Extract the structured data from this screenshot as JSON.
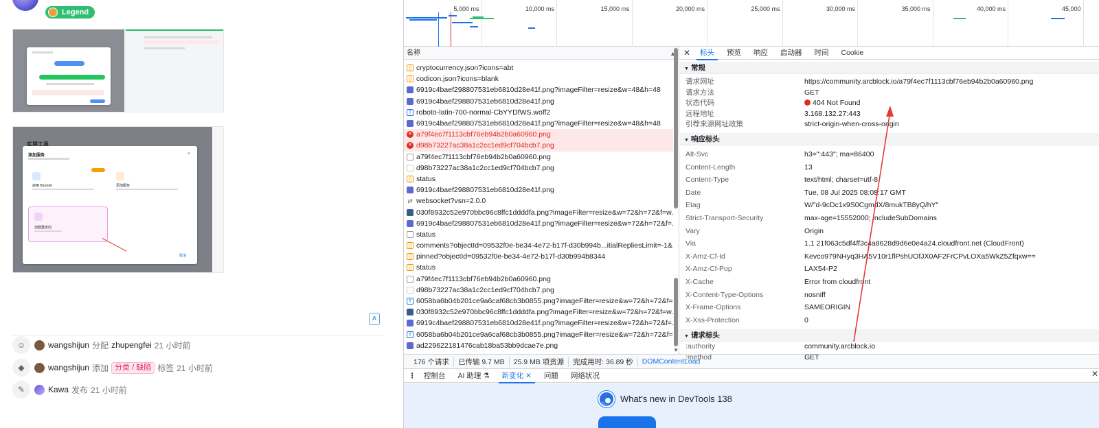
{
  "left": {
    "badge": "Legend",
    "activity": [
      {
        "icon": "person-icon",
        "user": "wangshijun",
        "action": "分配",
        "target": "zhupengfei",
        "time": "21 小时前"
      },
      {
        "icon": "tag-icon",
        "user": "wangshijun",
        "action": "添加",
        "tag": "分类 / 缺陷",
        "suffix": "标签",
        "time": "21 小时前"
      },
      {
        "icon": "pencil-icon",
        "user": "Kawa",
        "action": "发布",
        "time": "21 小时前"
      }
    ],
    "thumb2_title": "实用工具",
    "thumb2_dialog_title": "添加服务",
    "thumb2_card1": "启用 Blocklet",
    "thumb2_card2": "添加服务",
    "thumb2_card3": "创建重定向",
    "thumb2_confirm": "取消"
  },
  "timeline": {
    "ticks": [
      "5,000 ms",
      "10,000 ms",
      "15,000 ms",
      "20,000 ms",
      "25,000 ms",
      "30,000 ms",
      "35,000 ms",
      "40,000 ms",
      "45,000"
    ]
  },
  "list": {
    "header": "名称",
    "rows": [
      {
        "type": "json",
        "name": "cryptocurrency.json?icons=abt"
      },
      {
        "type": "json",
        "name": "codicon.json?icons=blank"
      },
      {
        "type": "png",
        "name": "6919c4baef298807531eb6810d28e41f.png?imageFilter=resize&w=48&h=48"
      },
      {
        "type": "png",
        "name": "6919c4baef298807531eb6810d28e41f.png"
      },
      {
        "type": "font",
        "name": "roboto-latin-700-normal-CbYYDfWS.woff2"
      },
      {
        "type": "png",
        "name": "6919c4baef298807531eb6810d28e41f.png?imageFilter=resize&w=48&h=48"
      },
      {
        "type": "err",
        "name": "a79f4ec7f1113cbf76eb94b2b0a60960.png"
      },
      {
        "type": "err",
        "name": "d98b73227ac38a1c2cc1ed9cf704bcb7.png"
      },
      {
        "type": "doc",
        "name": "a79f4ec7f1113cbf76eb94b2b0a60960.png"
      },
      {
        "type": "blank",
        "name": "d98b73227ac38a1c2cc1ed9cf704bcb7.png"
      },
      {
        "type": "json",
        "name": "status"
      },
      {
        "type": "png",
        "name": "6919c4baef298807531eb6810d28e41f.png"
      },
      {
        "type": "ws",
        "name": "websocket?vsn=2.0.0"
      },
      {
        "type": "av",
        "name": "030f8932c52e970bbc96c8ffc1ddddfa.png?imageFilter=resize&w=72&h=72&f=w..."
      },
      {
        "type": "png",
        "name": "6919c4baef298807531eb6810d28e41f.png?imageFilter=resize&w=72&h=72&f=..."
      },
      {
        "type": "doc",
        "name": "status"
      },
      {
        "type": "json",
        "name": "comments?objectId=09532f0e-be34-4e72-b17f-d30b994b...itialRepliesLimit=-1&..."
      },
      {
        "type": "json",
        "name": "pinned?objectId=09532f0e-be34-4e72-b17f-d30b994b8344"
      },
      {
        "type": "json",
        "name": "status"
      },
      {
        "type": "doc",
        "name": "a79f4ec7f1113cbf76eb94b2b0a60960.png"
      },
      {
        "type": "blank",
        "name": "d98b73227ac38a1c2cc1ed9cf704bcb7.png"
      },
      {
        "type": "font",
        "name": "6058ba6b04b201ce9a6caf68cb3b0855.png?imageFilter=resize&w=72&h=72&f=..."
      },
      {
        "type": "av",
        "name": "030f8932c52e970bbc96c8ffc1ddddfa.png?imageFilter=resize&w=72&h=72&f=w..."
      },
      {
        "type": "png",
        "name": "6919c4baef298807531eb6810d28e41f.png?imageFilter=resize&w=72&h=72&f=..."
      },
      {
        "type": "font",
        "name": "6058ba6b04b201ce9a6caf68cb3b0855.png?imageFilter=resize&w=72&h=72&f=..."
      },
      {
        "type": "jpg",
        "name": "ad229622181476cab18ba53bb9dcae7e.png"
      }
    ]
  },
  "status": {
    "requests": "176 个请求",
    "transferred": "已传输 9.7 MB",
    "resources": "25.9 MB 项资源",
    "finish": "完成用时: 36.89 秒",
    "dcl": "DOMContentLoad"
  },
  "headers": {
    "tabs": [
      "标头",
      "预览",
      "响应",
      "启动器",
      "时间",
      "Cookie"
    ],
    "general_title": "常规",
    "general": [
      {
        "k": "请求网址",
        "v": "https://community.arcblock.io/a79f4ec7f1113cbf76eb94b2b0a60960.png"
      },
      {
        "k": "请求方法",
        "v": "GET"
      },
      {
        "k": "状态代码",
        "v": "404 Not Found"
      },
      {
        "k": "远程地址",
        "v": "3.168.132.27:443"
      },
      {
        "k": "引荐来源网址政策",
        "v": "strict-origin-when-cross-origin"
      }
    ],
    "response_title": "响应标头",
    "response": [
      {
        "k": "Alt-Svc",
        "v": "h3=\":443\"; ma=86400"
      },
      {
        "k": "Content-Length",
        "v": "13"
      },
      {
        "k": "Content-Type",
        "v": "text/html; charset=utf-8"
      },
      {
        "k": "Date",
        "v": "Tue, 08 Jul 2025 08:08:17 GMT"
      },
      {
        "k": "Etag",
        "v": "W/\"d-9cDc1x9S0CgmdX/8mukTB8yQ/hY\""
      },
      {
        "k": "Strict-Transport-Security",
        "v": "max-age=15552000; includeSubDomains"
      },
      {
        "k": "Vary",
        "v": "Origin"
      },
      {
        "k": "Via",
        "v": "1.1 21f063c5df4ff3c4a8628d9d6e0e4a24.cloudfront.net (CloudFront)"
      },
      {
        "k": "X-Amz-Cf-Id",
        "v": "Kevco979NHyq3HA5V10r1flPshUOfJX0AF2FrCPvLOXa5WkZ5Zfqxw=="
      },
      {
        "k": "X-Amz-Cf-Pop",
        "v": "LAX54-P2"
      },
      {
        "k": "X-Cache",
        "v": "Error from cloudfront"
      },
      {
        "k": "X-Content-Type-Options",
        "v": "nosniff"
      },
      {
        "k": "X-Frame-Options",
        "v": "SAMEORIGIN"
      },
      {
        "k": "X-Xss-Protection",
        "v": "0"
      }
    ],
    "request_title": "请求标头",
    "request": [
      {
        "k": ":authority",
        "v": "community.arcblock.io"
      },
      {
        "k": ":method",
        "v": "GET"
      }
    ]
  },
  "drawer": {
    "tabs": [
      "控制台",
      "AI 助理 ⚗",
      "新变化",
      "问题",
      "网络状况"
    ],
    "active_tab": "新变化",
    "whats_new": "What's new in DevTools 138"
  }
}
